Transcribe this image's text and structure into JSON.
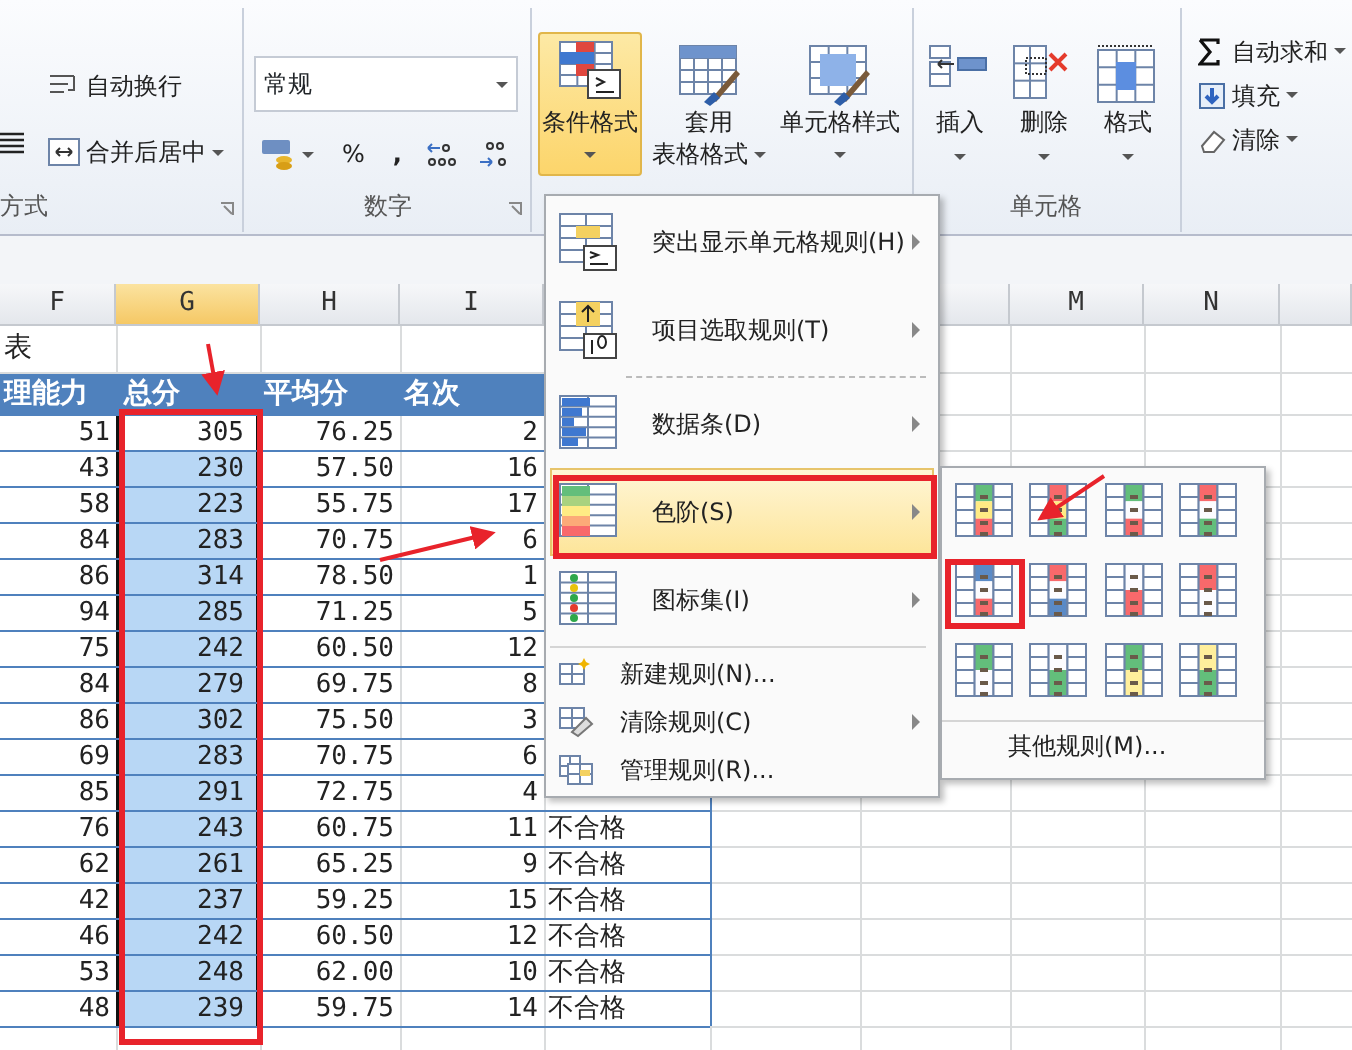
{
  "ribbon": {
    "alignment": {
      "label": "方式",
      "wrap_text": "自动换行",
      "merge_center": "合并后居中"
    },
    "number": {
      "label": "数字",
      "format": "常规",
      "percent": "%",
      "comma": ","
    },
    "styles": [
      {
        "lines": [
          "条件格式"
        ],
        "active": true
      },
      {
        "lines": [
          "套用",
          "表格格式"
        ],
        "active": false
      },
      {
        "lines": [
          "单元格样式"
        ],
        "active": false
      }
    ],
    "cells": {
      "label": "单元格",
      "buttons": [
        "插入",
        "删除",
        "格式"
      ]
    },
    "editing": [
      {
        "label": "自动求和",
        "kind": "sum"
      },
      {
        "label": "填充",
        "kind": "fill"
      },
      {
        "label": "清除",
        "kind": "clear"
      }
    ]
  },
  "sheet": {
    "columns": [
      {
        "name": "F",
        "selected": false
      },
      {
        "name": "G",
        "selected": true
      },
      {
        "name": "H",
        "selected": false
      },
      {
        "name": "I",
        "selected": false
      },
      {
        "name": "M",
        "selected": false
      },
      {
        "name": "N",
        "selected": false
      }
    ],
    "title": "表",
    "headers": [
      "理能力",
      "总分",
      "平均分",
      "名次"
    ],
    "rows": [
      {
        "f": "51",
        "g": "305",
        "h": "76.25",
        "i": "2",
        "active": true
      },
      {
        "f": "43",
        "g": "230",
        "h": "57.50",
        "i": "16",
        "active": false
      },
      {
        "f": "58",
        "g": "223",
        "h": "55.75",
        "i": "17",
        "active": false
      },
      {
        "f": "84",
        "g": "283",
        "h": "70.75",
        "i": "6",
        "active": false
      },
      {
        "f": "86",
        "g": "314",
        "h": "78.50",
        "i": "1",
        "active": false
      },
      {
        "f": "94",
        "g": "285",
        "h": "71.25",
        "i": "5",
        "active": false
      },
      {
        "f": "75",
        "g": "242",
        "h": "60.50",
        "i": "12",
        "active": false
      },
      {
        "f": "84",
        "g": "279",
        "h": "69.75",
        "i": "8",
        "active": false
      },
      {
        "f": "86",
        "g": "302",
        "h": "75.50",
        "i": "3",
        "active": false
      },
      {
        "f": "69",
        "g": "283",
        "h": "70.75",
        "i": "6",
        "active": false
      },
      {
        "f": "85",
        "g": "291",
        "h": "72.75",
        "i": "4",
        "active": false
      },
      {
        "f": "76",
        "g": "243",
        "h": "60.75",
        "i": "11",
        "j": "不合格",
        "active": false
      },
      {
        "f": "62",
        "g": "261",
        "h": "65.25",
        "i": "9",
        "j": "不合格",
        "active": false
      },
      {
        "f": "42",
        "g": "237",
        "h": "59.25",
        "i": "15",
        "j": "不合格",
        "active": false
      },
      {
        "f": "46",
        "g": "242",
        "h": "60.50",
        "i": "12",
        "j": "不合格",
        "active": false
      },
      {
        "f": "53",
        "g": "248",
        "h": "62.00",
        "i": "10",
        "j": "不合格",
        "active": false
      },
      {
        "f": "48",
        "g": "239",
        "h": "59.75",
        "i": "14",
        "j": "不合格",
        "active": false
      }
    ]
  },
  "menu": {
    "items": [
      {
        "kind": "large",
        "label": "突出显示单元格规则(H)",
        "submenu": true,
        "highlighted": false
      },
      {
        "kind": "large",
        "label": "项目选取规则(T)",
        "submenu": true,
        "highlighted": false
      },
      {
        "kind": "dashed-separator"
      },
      {
        "kind": "large",
        "label": "数据条(D)",
        "submenu": true,
        "highlighted": false
      },
      {
        "kind": "large",
        "label": "色阶(S)",
        "submenu": true,
        "highlighted": true
      },
      {
        "kind": "large",
        "label": "图标集(I)",
        "submenu": true,
        "highlighted": false
      },
      {
        "kind": "separator"
      },
      {
        "kind": "small",
        "label": "新建规则(N)...",
        "submenu": false,
        "highlighted": false
      },
      {
        "kind": "small",
        "label": "清除规则(C)",
        "submenu": true,
        "highlighted": false
      },
      {
        "kind": "small",
        "label": "管理规则(R)...",
        "submenu": false,
        "highlighted": false
      }
    ]
  },
  "color_scales": {
    "scales": [
      {
        "stops": [
          {
            "color": "#63be7b"
          },
          {
            "color": "#ffeb84"
          },
          {
            "color": "#f8696b"
          }
        ]
      },
      {
        "stops": [
          {
            "color": "#f8696b"
          },
          {
            "color": "#ffeb84"
          },
          {
            "color": "#63be7b"
          }
        ]
      },
      {
        "stops": [
          {
            "color": "#63be7b"
          },
          {
            "color": "#fcfcff"
          },
          {
            "color": "#f8696b"
          }
        ]
      },
      {
        "stops": [
          {
            "color": "#f8696b"
          },
          {
            "color": "#fcfcff"
          },
          {
            "color": "#63be7b"
          }
        ]
      },
      {
        "stops": [
          {
            "color": "#5a8ac6"
          },
          {
            "color": "#fcfcff"
          },
          {
            "color": "#f8696b"
          }
        ]
      },
      {
        "stops": [
          {
            "color": "#f8696b"
          },
          {
            "color": "#fcfcff"
          },
          {
            "color": "#5a8ac6"
          }
        ]
      },
      {
        "stops": [
          {
            "color": "#fcfcff"
          },
          {
            "color": "#f8696b"
          }
        ]
      },
      {
        "stops": [
          {
            "color": "#f8696b"
          },
          {
            "color": "#fcfcff"
          }
        ]
      },
      {
        "stops": [
          {
            "color": "#63be7b"
          },
          {
            "color": "#fcfcff"
          }
        ]
      },
      {
        "stops": [
          {
            "color": "#fcfcff"
          },
          {
            "color": "#63be7b"
          }
        ]
      },
      {
        "stops": [
          {
            "color": "#63be7b"
          },
          {
            "color": "#ffef9c"
          }
        ]
      },
      {
        "stops": [
          {
            "color": "#ffef9c"
          },
          {
            "color": "#63be7b"
          }
        ]
      }
    ],
    "more": "其他规则(M)..."
  }
}
